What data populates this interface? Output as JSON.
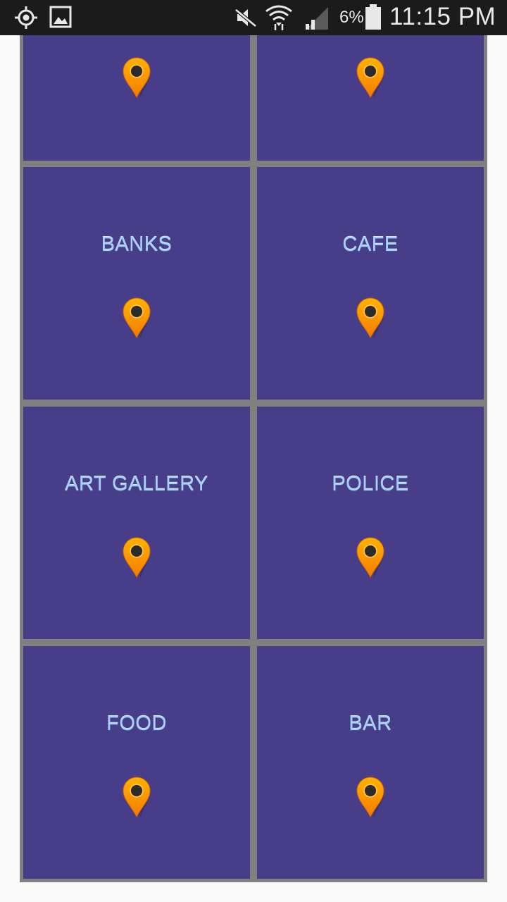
{
  "status_bar": {
    "battery_percent": "6%",
    "time": "11:15 PM",
    "icons": [
      "location-target-icon",
      "image-icon",
      "mute-icon",
      "wifi-icon",
      "signal-icon",
      "battery-icon"
    ]
  },
  "tiles": [
    {
      "label": "",
      "icon": "map-pin-icon"
    },
    {
      "label": "",
      "icon": "map-pin-icon"
    },
    {
      "label": "BANKS",
      "icon": "map-pin-icon"
    },
    {
      "label": "CAFE",
      "icon": "map-pin-icon"
    },
    {
      "label": "ART GALLERY",
      "icon": "map-pin-icon"
    },
    {
      "label": "POLICE",
      "icon": "map-pin-icon"
    },
    {
      "label": "FOOD",
      "icon": "map-pin-icon"
    },
    {
      "label": "BAR",
      "icon": "map-pin-icon"
    }
  ],
  "colors": {
    "tile_background": "#473d89",
    "grid_lines": "#808080",
    "label_text": "#a9cef7",
    "pin": "#f57c00",
    "status_bar": "#1b1b1b"
  }
}
